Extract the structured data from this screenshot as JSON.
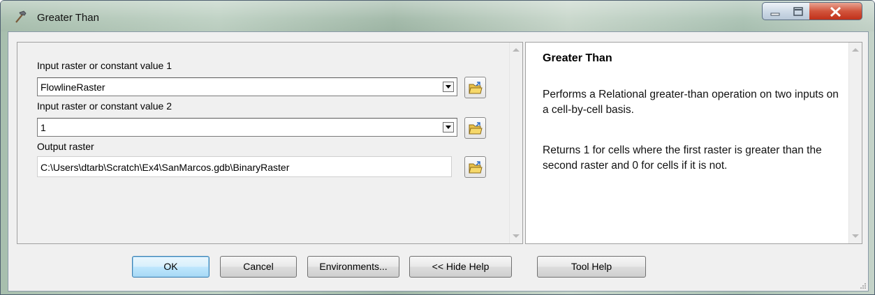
{
  "window": {
    "title": "Greater Than",
    "icon": "hammer-icon",
    "controls": [
      "minimize-icon",
      "maximize-icon",
      "close-icon"
    ]
  },
  "params": {
    "input1": {
      "label": "Input raster or constant value 1",
      "value": "FlowlineRaster",
      "icon": "open-folder-icon"
    },
    "input2": {
      "label": "Input raster or constant value 2",
      "value": "1",
      "icon": "open-folder-icon"
    },
    "output": {
      "label": "Output raster",
      "value": "C:\\Users\\dtarb\\Scratch\\Ex4\\SanMarcos.gdb\\BinaryRaster",
      "icon": "open-folder-icon"
    }
  },
  "help": {
    "title": "Greater Than",
    "p1": "Performs a Relational greater-than operation on two inputs on a cell-by-cell basis.",
    "p2": "Returns 1 for cells where the first raster is greater than the second raster and 0 for cells if it is not."
  },
  "buttons": {
    "ok": "OK",
    "cancel": "Cancel",
    "environments": "Environments...",
    "hide_help": "<< Hide Help",
    "tool_help": "Tool Help"
  }
}
